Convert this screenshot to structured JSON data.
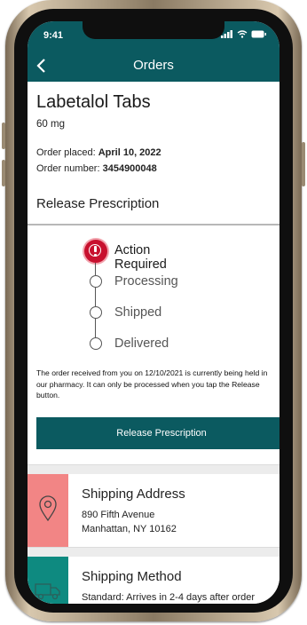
{
  "status_bar": {
    "time": "9:41"
  },
  "nav": {
    "title": "Orders"
  },
  "product": {
    "name": "Labetalol Tabs",
    "dose": "60 mg"
  },
  "order": {
    "placed_label": "Order placed:",
    "placed_value": "April 10, 2022",
    "number_label": "Order number:",
    "number_value": "3454900048"
  },
  "release_section": {
    "title": "Release Prescription"
  },
  "steps": [
    {
      "label": "Action Required"
    },
    {
      "label": "Processing"
    },
    {
      "label": "Shipped"
    },
    {
      "label": "Delivered"
    }
  ],
  "note": "The order received from you on 12/10/2021 is currently being held in our pharmacy. It can only be processed when you tap the Release button.",
  "release_button": {
    "label": "Release Prescription"
  },
  "shipping_address": {
    "title": "Shipping Address",
    "line1": "890 Fifth Avenue",
    "line2": "Manhattan, NY 10162",
    "icon": "location-pin-icon",
    "color": "#f28585"
  },
  "shipping_method": {
    "title": "Shipping Method",
    "line1": "Standard: Arrives in 2-4 days after order",
    "icon": "truck-icon",
    "color": "#0e8a80"
  },
  "colors": {
    "brand": "#0b5a60",
    "alert": "#c8102e"
  }
}
